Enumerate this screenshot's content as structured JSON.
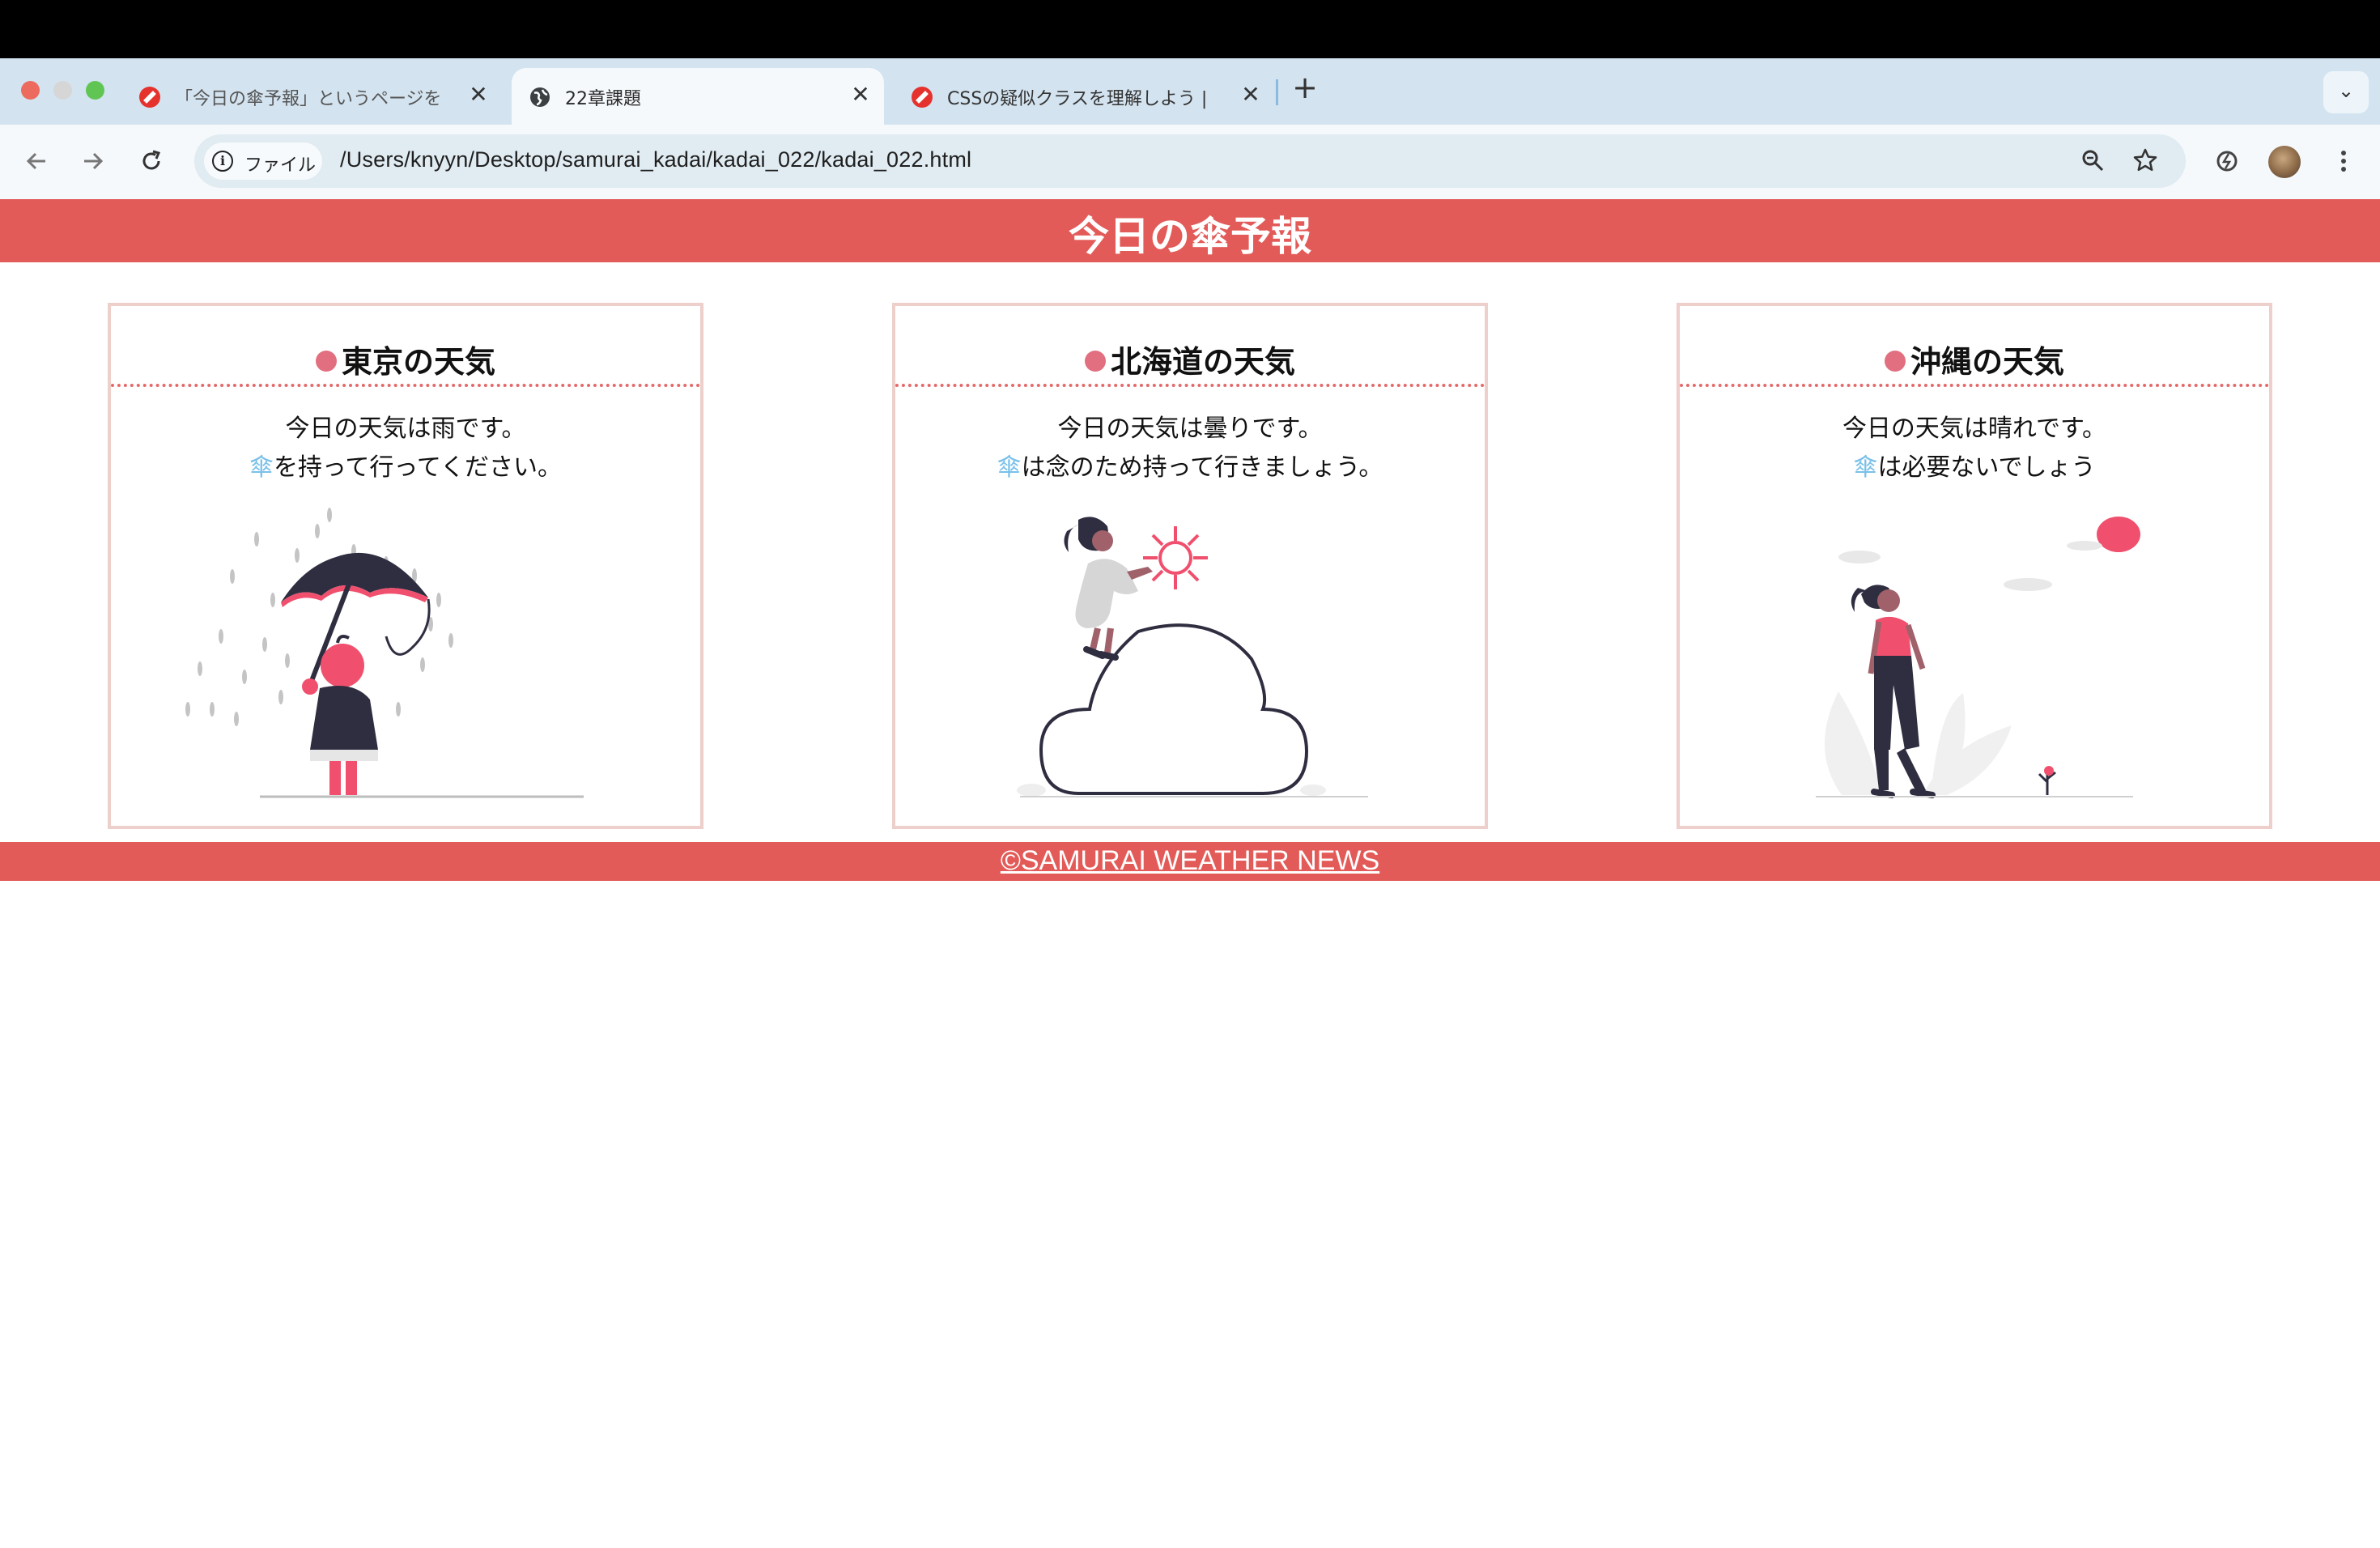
{
  "browser": {
    "tabs": [
      {
        "title": "「今日の傘予報」というページを",
        "active": false,
        "icon": "samurai-logo-icon"
      },
      {
        "title": "22章課題",
        "active": true,
        "icon": "globe-icon"
      },
      {
        "title": "CSSの疑似クラスを理解しよう |",
        "active": false,
        "icon": "samurai-logo-icon"
      }
    ],
    "chip_label": "ファイル",
    "url": "/Users/knyyn/Desktop/samurai_kadai/kadai_022/kadai_022.html",
    "close_glyph": "✕",
    "new_tab_glyph": "+",
    "tab_search_glyph": "⌄"
  },
  "page": {
    "title": "今日の傘予報",
    "cards": [
      {
        "heading": "東京の天気",
        "line1": "今日の天気は雨です。",
        "umbrella": "傘",
        "line2": "を持って行ってください。",
        "illustration": "rain-umbrella-person"
      },
      {
        "heading": "北海道の天気",
        "line1": "今日の天気は曇りです。",
        "umbrella": "傘",
        "line2": "は念のため持って行きましょう。",
        "illustration": "person-on-cloud-with-sun"
      },
      {
        "heading": "沖縄の天気",
        "line1": "今日の天気は晴れです。",
        "umbrella": "傘",
        "line2": "は必要ないでしょう",
        "illustration": "woman-walking-sunny"
      }
    ],
    "footer": "©SAMURAI WEATHER NEWS"
  },
  "colors": {
    "header_bg": "#e35b58",
    "card_border": "#edcfcb",
    "dot": "#e26f80",
    "umbrella_text": "#79c0ea",
    "tabstrip_bg": "#d3e3ef",
    "accent_pink": "#f0506e",
    "ink": "#2f2e41"
  }
}
